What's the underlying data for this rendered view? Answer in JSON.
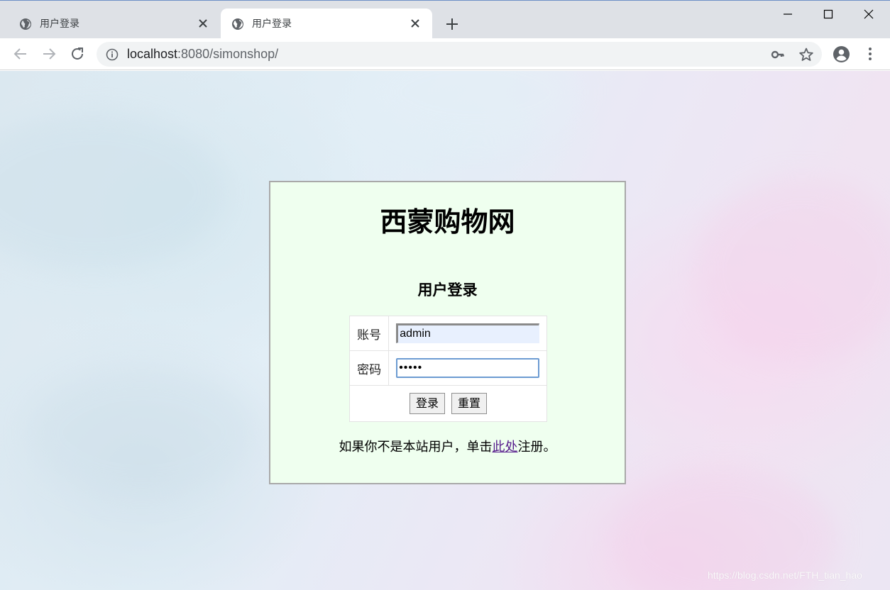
{
  "browser": {
    "tabs": [
      {
        "title": "用户登录",
        "icon": "globe-icon",
        "active": false
      },
      {
        "title": "用户登录",
        "icon": "globe-icon",
        "active": true
      }
    ],
    "url": {
      "host": "localhost",
      "rest": ":8080/simonshop/"
    }
  },
  "page": {
    "site_title": "西蒙购物网",
    "form_title": "用户登录",
    "fields": {
      "account_label": "账号",
      "account_value": "admin",
      "password_label": "密码",
      "password_value": "•••••"
    },
    "buttons": {
      "login": "登录",
      "reset": "重置"
    },
    "register": {
      "prefix": "如果你不是本站用户，单击",
      "link": "此处",
      "suffix": "注册。"
    },
    "colors": {
      "box_bg": "#efffef",
      "link": "#551a8b"
    }
  },
  "watermark": "https://blog.csdn.net/FTH_tian_hao"
}
